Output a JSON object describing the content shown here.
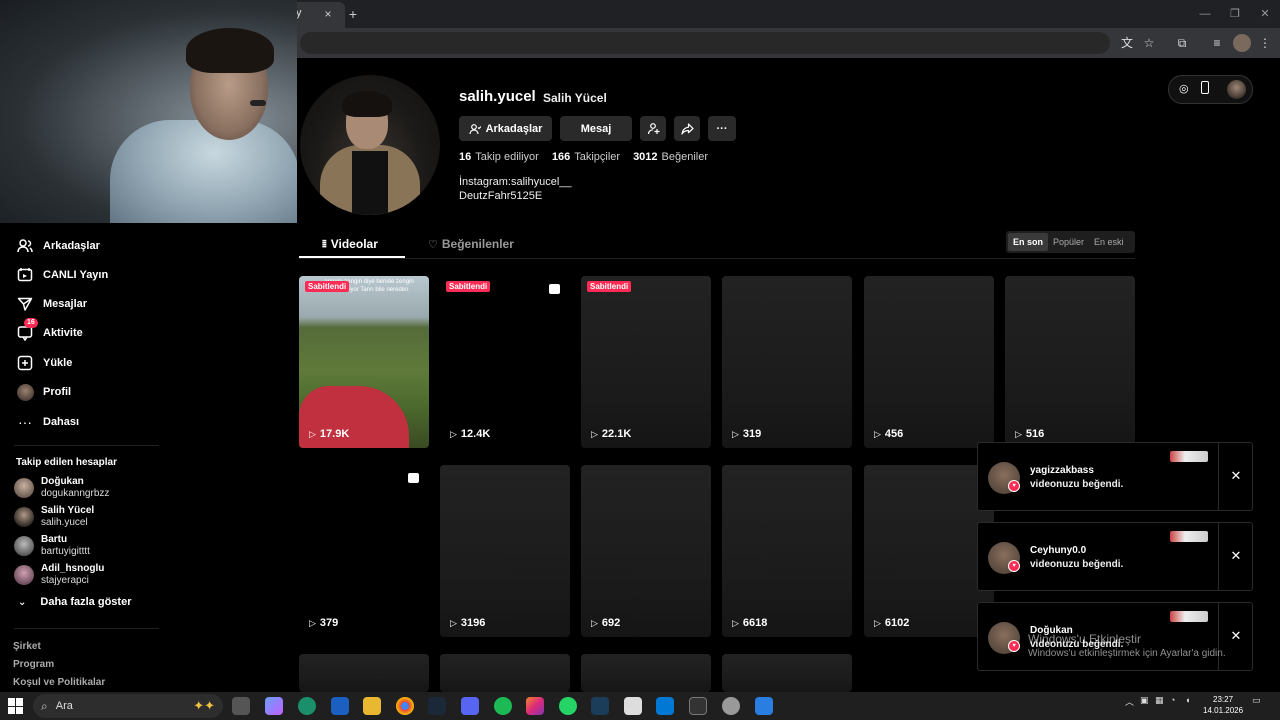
{
  "browser": {
    "tab_close": "×",
    "new_tab": "+",
    "window_controls": [
      "—",
      "❐",
      "✕"
    ],
    "tab_fragment": "y"
  },
  "sidebar": {
    "nav": [
      {
        "label": "Arkadaşlar",
        "icon": "friends-icon"
      },
      {
        "label": "CANLI Yayın",
        "icon": "live-icon"
      },
      {
        "label": "Mesajlar",
        "icon": "messages-icon"
      },
      {
        "label": "Aktivite",
        "icon": "activity-icon",
        "badge": "16"
      },
      {
        "label": "Yükle",
        "icon": "upload-icon"
      },
      {
        "label": "Profil",
        "icon": "profile-avatar-icon"
      },
      {
        "label": "Dahası",
        "icon": "more-icon"
      }
    ],
    "following_title": "Takip edilen hesaplar",
    "accounts": [
      {
        "name": "Doğukan",
        "username": "dogukanngrbzz"
      },
      {
        "name": "Salih Yücel",
        "username": "salih.yucel"
      },
      {
        "name": "Bartu",
        "username": "bartuyigitttt"
      },
      {
        "name": "Adil_hsnoglu",
        "username": "stajyerapci"
      }
    ],
    "show_more": "Daha fazla göster",
    "footer": [
      "Şirket",
      "Program",
      "Koşul ve Politikalar"
    ]
  },
  "profile": {
    "username": "salih.yucel",
    "display_name": "Salih Yücel",
    "buttons": {
      "friends": "Arkadaşlar",
      "message": "Mesaj",
      "more": "···"
    },
    "stats": [
      {
        "value": "16",
        "label": "Takip ediliyor"
      },
      {
        "value": "166",
        "label": "Takipçiler"
      },
      {
        "value": "3012",
        "label": "Beğeniler"
      }
    ],
    "bio_line1": "İnstagram:salihyucel__",
    "bio_line2": "DeutzFahr5125E"
  },
  "tabs": {
    "videos": "Videolar",
    "liked": "Beğenilenler",
    "sort": [
      "En son",
      "Popüler",
      "En eski"
    ]
  },
  "videos": [
    {
      "views": "17.9K",
      "pinned": "Sabitlendi",
      "caption": "annem zengin diye benide zengin zannediyor Tanrı bile nereden"
    },
    {
      "views": "12.4K",
      "pinned": "Sabitlendi",
      "photo": true
    },
    {
      "views": "22.1K",
      "pinned": "Sabitlendi"
    },
    {
      "views": "319"
    },
    {
      "views": "456"
    },
    {
      "views": "516"
    },
    {
      "views": "379",
      "photo": true
    },
    {
      "views": "3196"
    },
    {
      "views": "692"
    },
    {
      "views": "6618"
    },
    {
      "views": "6102"
    }
  ],
  "notifications": [
    {
      "name": "yagizzakbass",
      "message": "videonuzu beğendi."
    },
    {
      "name": "Ceyhuny0.0",
      "message": "videonuzu beğendi."
    },
    {
      "name": "Doğukan",
      "message": "videonuzu beğendi."
    }
  ],
  "watermark": {
    "title": "Windows'u Etkinleştir",
    "subtitle": "Windows'u etkinleştirmek için Ayarlar'a gidin."
  },
  "taskbar": {
    "search_label": "Ara",
    "time": "23:27",
    "date": "14.01.2026"
  },
  "colors": {
    "accent": "#fe2c55",
    "background": "#000000",
    "button": "#2a2a2a"
  }
}
